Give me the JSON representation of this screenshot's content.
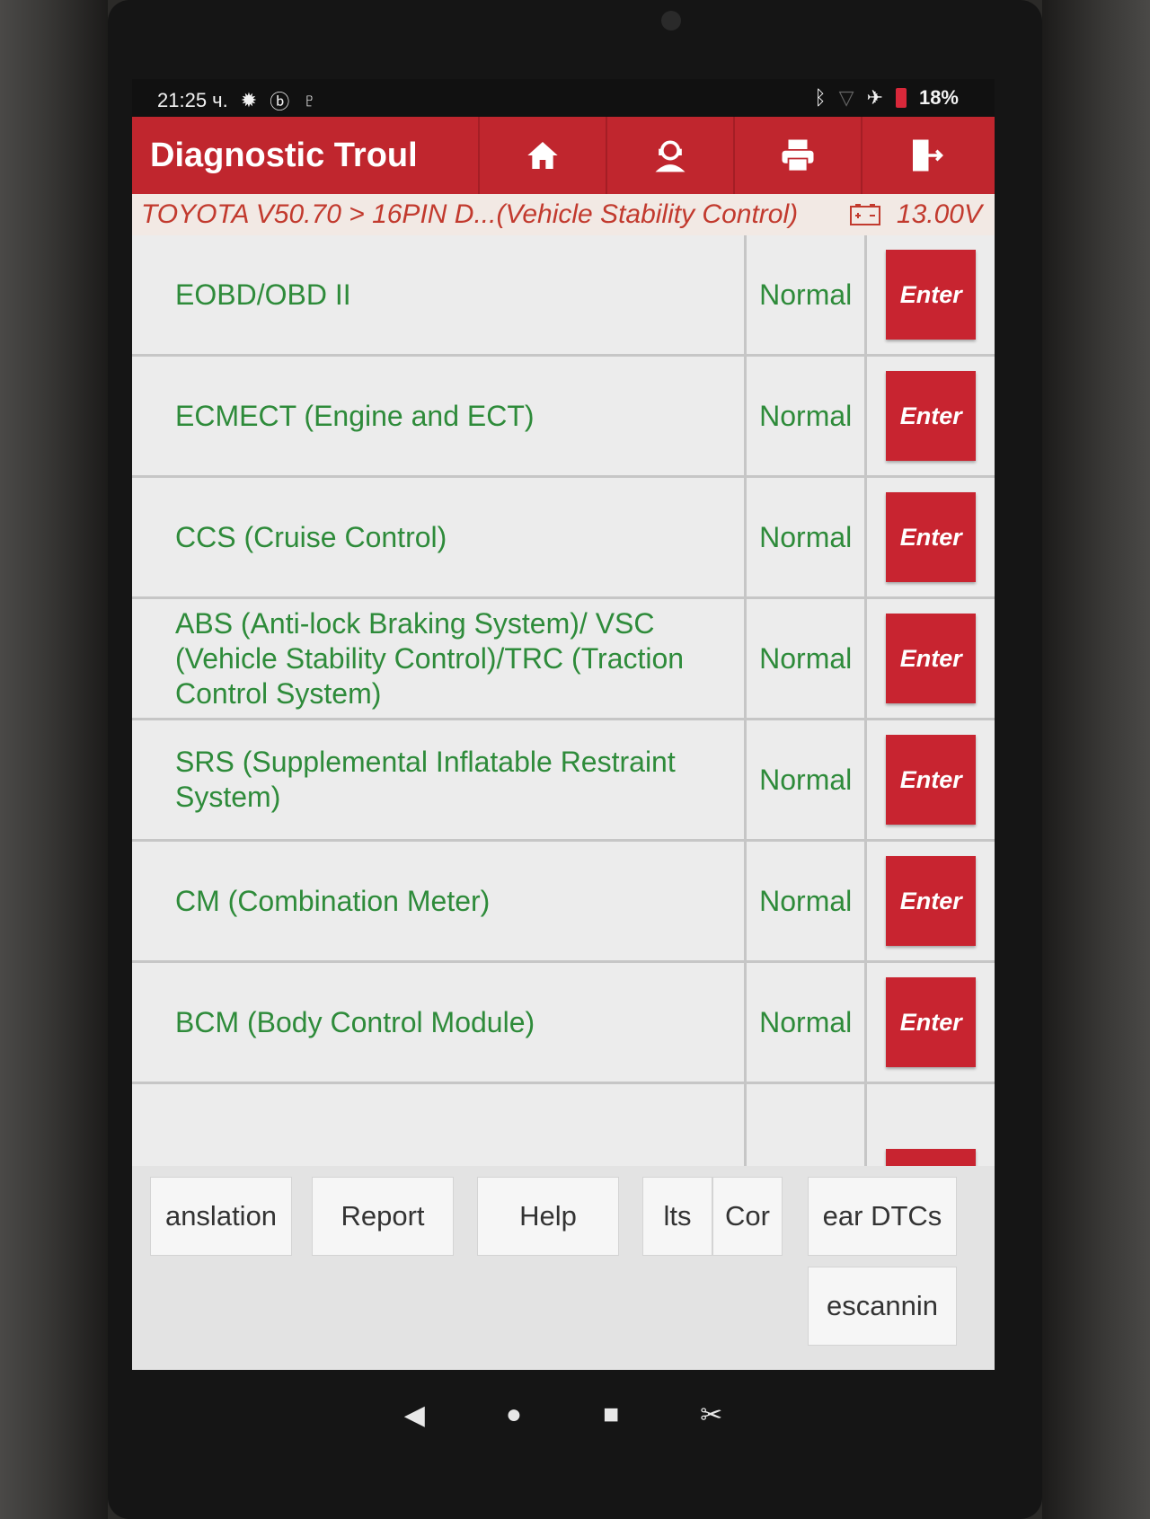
{
  "status_bar": {
    "time": "21:25 ч.",
    "left_icons": [
      "gear-icon",
      "bluetooth-circle-icon",
      "stethoscope-icon"
    ],
    "right_icons": [
      "bluetooth-icon",
      "signal-icon",
      "airplane-icon"
    ],
    "battery": "18%"
  },
  "app_bar": {
    "title": "Diagnostic Troul",
    "buttons": [
      "home-icon",
      "support-icon",
      "print-icon",
      "exit-icon"
    ]
  },
  "breadcrumb": {
    "path": "TOYOTA V50.70 > 16PIN D...(Vehicle Stability Control)",
    "voltage": "13.00V"
  },
  "systems": [
    {
      "name": "EOBD/OBD II",
      "status": "Normal",
      "action": "Enter"
    },
    {
      "name": "ECMECT (Engine and ECT)",
      "status": "Normal",
      "action": "Enter"
    },
    {
      "name": "CCS (Cruise Control)",
      "status": "Normal",
      "action": "Enter"
    },
    {
      "name": "ABS (Anti-lock Braking System)/ VSC (Vehicle Stability Control)/TRC (Traction Control System)",
      "status": "Normal",
      "action": "Enter"
    },
    {
      "name": "SRS (Supplemental Inflatable Restraint System)",
      "status": "Normal",
      "action": "Enter"
    },
    {
      "name": "CM (Combination Meter)",
      "status": "Normal",
      "action": "Enter"
    },
    {
      "name": "BCM (Body Control Module)",
      "status": "Normal",
      "action": "Enter"
    }
  ],
  "toolbar": {
    "translation": "anslation",
    "report": "Report",
    "help": "Help",
    "results": "lts",
    "component": "Cor",
    "clear_dtcs": "ear DTCs",
    "rescanning": "escannin"
  },
  "system_nav": [
    "back-icon",
    "home-dot-icon",
    "recents-icon",
    "screenshot-icon"
  ],
  "colors": {
    "accent_red": "#c0262e",
    "status_green": "#2e8b3a",
    "breadcrumb_text": "#c23a2e"
  }
}
